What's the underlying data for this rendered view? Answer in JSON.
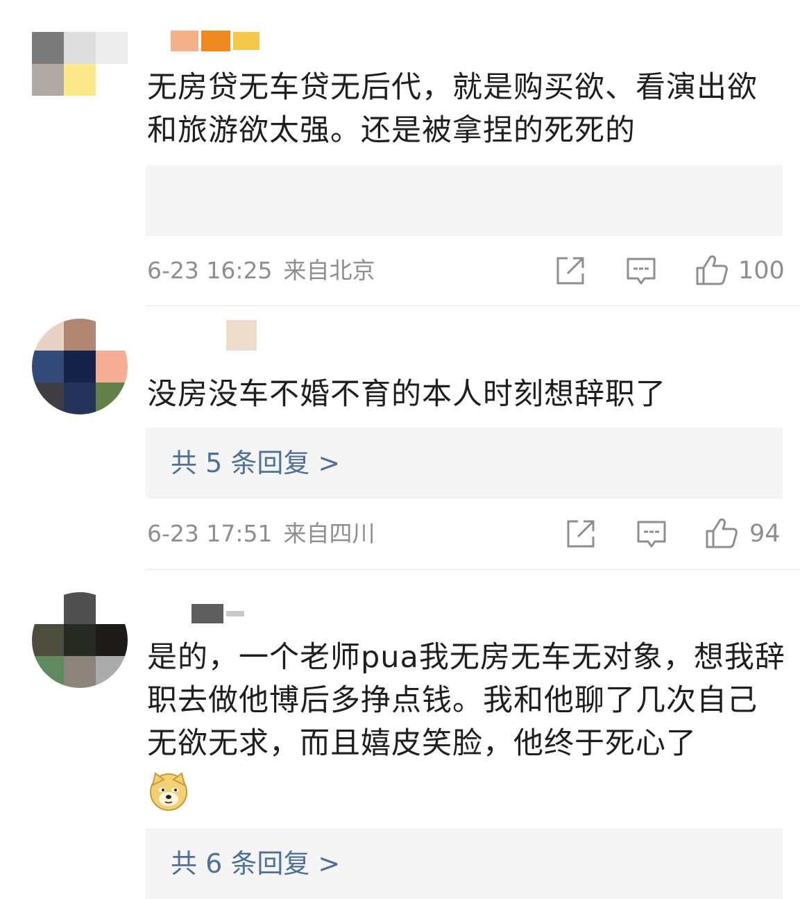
{
  "comments": [
    {
      "text": "无房贷无车贷无后代，就是购买欲、看演出欲和旅游欲太强。还是被拿捏的死死的",
      "time": "6-23 16:25",
      "location": "来自北京",
      "likes": "100",
      "reply_label": ""
    },
    {
      "text": "没房没车不婚不育的本人时刻想辞职了",
      "time": "6-23 17:51",
      "location": "来自四川",
      "likes": "94",
      "reply_label": "共 5 条回复 >"
    },
    {
      "text": "是的，一个老师pua我无房无车无对象，想我辞职去做他博后多挣点钱。我和他聊了几次自己无欲无求，而且嬉皮笑脸，他终于死心了",
      "reply_label": "共 6 条回复 >"
    }
  ],
  "icons": {
    "share": "share-icon",
    "comment": "comment-icon",
    "like": "thumbs-up-icon",
    "emoji": "doge-emoji-icon"
  },
  "colors": {
    "link": "#4f6f9b",
    "meta": "#8e8e8e",
    "reply_bg": "#f5f5f5"
  }
}
